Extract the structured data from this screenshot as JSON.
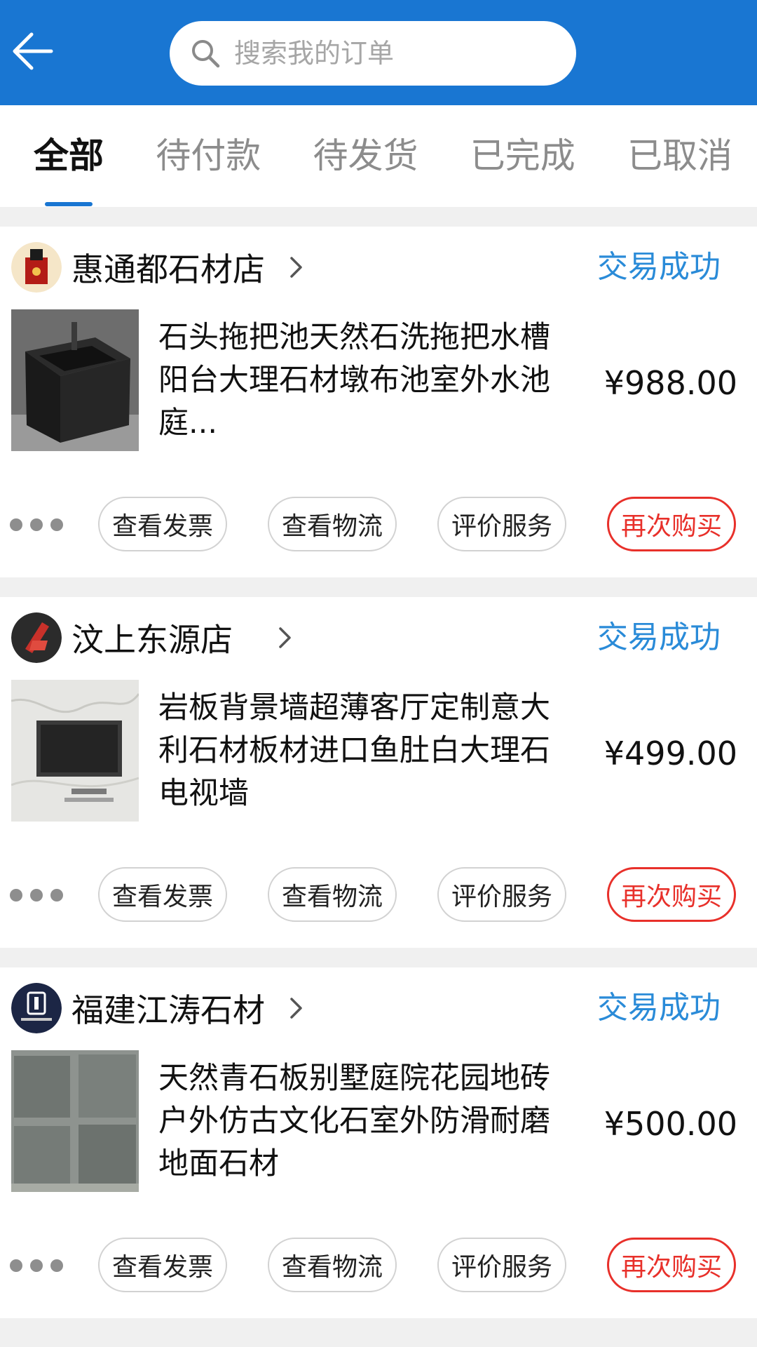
{
  "search": {
    "placeholder": "搜索我的订单"
  },
  "tabs": [
    {
      "label": "全部",
      "active": true
    },
    {
      "label": "待付款",
      "active": false
    },
    {
      "label": "待发货",
      "active": false
    },
    {
      "label": "已完成",
      "active": false
    },
    {
      "label": "已取消",
      "active": false
    }
  ],
  "orders": [
    {
      "shop": "惠通都石材店",
      "status": "交易成功",
      "title": "石头拖把池天然石洗拖把水槽阳台大理石材墩布池室外水池庭...",
      "price": "¥988.00",
      "actions": {
        "more": "more",
        "invoice": "查看发票",
        "logistics": "查看物流",
        "review": "评价服务",
        "rebuy": "再次购买"
      }
    },
    {
      "shop": "汶上东源店",
      "status": "交易成功",
      "title": "岩板背景墙超薄客厅定制意大利石材板材进口鱼肚白大理石电视墙",
      "price": "¥499.00",
      "actions": {
        "more": "more",
        "invoice": "查看发票",
        "logistics": "查看物流",
        "review": "评价服务",
        "rebuy": "再次购买"
      }
    },
    {
      "shop": "福建江涛石材",
      "status": "交易成功",
      "title": "天然青石板别墅庭院花园地砖户外仿古文化石室外防滑耐磨地面石材",
      "price": "¥500.00",
      "actions": {
        "more": "more",
        "invoice": "查看发票",
        "logistics": "查看物流",
        "review": "评价服务",
        "rebuy": "再次购买"
      }
    }
  ],
  "colors": {
    "header": "#1976d2",
    "status": "#2a8bd8",
    "rebuy": "#e8302a",
    "separator": "#f0f0f0"
  },
  "icons": {
    "back": "arrow-left-icon",
    "search": "search-icon",
    "shop_chevron": "chevron-right-icon",
    "more": "more-dots-icon"
  }
}
